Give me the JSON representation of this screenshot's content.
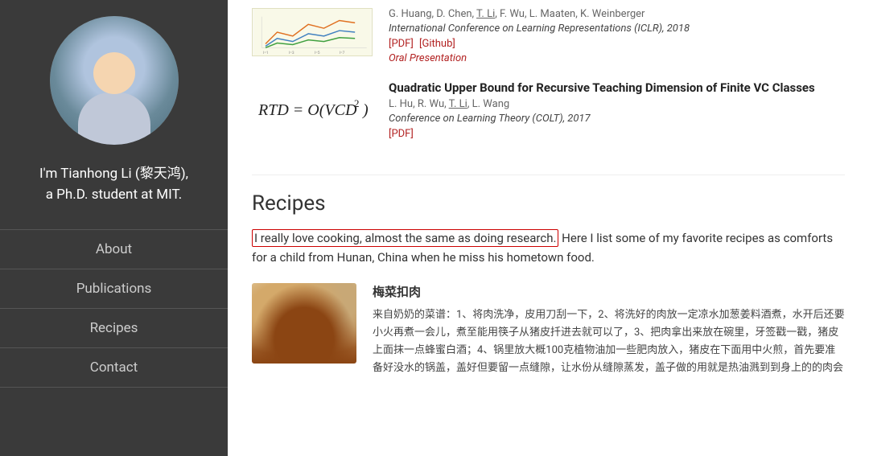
{
  "sidebar": {
    "name_line1": "I'm Tianhong Li (黎天鸿),",
    "name_line2": "a Ph.D. student at MIT.",
    "nav": [
      {
        "label": "About",
        "id": "about"
      },
      {
        "label": "Publications",
        "id": "publications"
      },
      {
        "label": "Recipes",
        "id": "recipes"
      },
      {
        "label": "Contact",
        "id": "contact"
      }
    ]
  },
  "publications": {
    "entries": [
      {
        "id": "pub1",
        "has_graph": true,
        "title": "",
        "authors_raw": "G. Huang, D. Chen, T. Li, F. Wu, L. Maaten, K. Weinberger",
        "authors_underline": "T. Li",
        "venue": "International Conference on Learning Representations (ICLR), 2018",
        "links": "[PDF] [Github]",
        "extra": "Oral Presentation"
      },
      {
        "id": "pub2",
        "has_formula": true,
        "title": "Quadratic Upper Bound for Recursive Teaching Dimension of Finite VC Classes",
        "authors_raw": "L. Hu, R. Wu, T. Li, L. Wang",
        "authors_underline": "T. Li",
        "venue": "Conference on Learning Theory (COLT), 2017",
        "links": "[PDF]",
        "extra": ""
      }
    ]
  },
  "recipes": {
    "section_title": "Recipes",
    "intro_highlight": "I really love cooking, almost the same as doing research.",
    "intro_rest": " Here I list some of my favorite recipes as comforts for a child from Hunan, China when he miss his hometown food.",
    "items": [
      {
        "id": "recipe1",
        "name": "梅菜扣肉",
        "description": "来自奶奶的菜谱：1、将肉洗净，皮用刀刮一下，2、将洗好的肉放一定凉水加葱姜料酒煮，水开后还要小火再煮一会儿，煮至能用筷子从猪皮扦进去就可以了，3、把肉拿出来放在碗里，牙签戳一戳，猪皮上面抹一点蜂蜜白酒；4、锅里放大概100克植物油加一些肥肉放入，猪皮在下面用中火煎，首先要准备好没水的锅盖，盖好但要留一点缝隙，让水份从缝隙蒸发，盖子做的用就是热油溅到到身上的的肉会合"
      }
    ]
  },
  "colors": {
    "sidebar_bg": "#3a3a3a",
    "link_red": "#b22222",
    "highlight_border": "#cc0000",
    "text_dark": "#222",
    "text_gray": "#666"
  }
}
